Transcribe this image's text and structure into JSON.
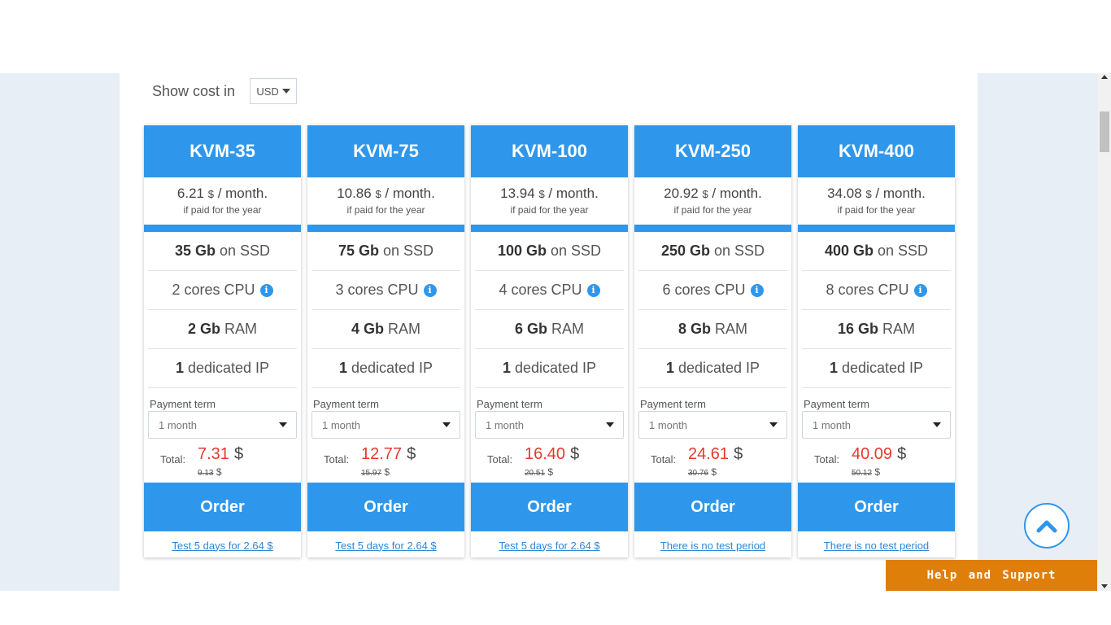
{
  "currency": {
    "label": "Show cost in",
    "selected": "USD"
  },
  "plans": [
    {
      "name": "KVM-35",
      "price": "6.21",
      "price_currency": "$",
      "price_unit": "/ month.",
      "price_note": "if paid for the year",
      "ssd_value": "35 Gb",
      "ssd_text": "on SSD",
      "cpu_text": "2 cores CPU",
      "ram_value": "2 Gb",
      "ram_text": "RAM",
      "ip_value": "1",
      "ip_text": "dedicated IP",
      "term_label": "Payment term",
      "term_value": "1 month",
      "total_label": "Total:",
      "total_value": "7.31",
      "total_currency": "$",
      "old_price": "9.13",
      "old_currency": "$",
      "order_label": "Order",
      "test_label": "Test 5 days for 2.64 $"
    },
    {
      "name": "KVM-75",
      "price": "10.86",
      "price_currency": "$",
      "price_unit": "/ month.",
      "price_note": "if paid for the year",
      "ssd_value": "75 Gb",
      "ssd_text": "on SSD",
      "cpu_text": "3 cores CPU",
      "ram_value": "4 Gb",
      "ram_text": "RAM",
      "ip_value": "1",
      "ip_text": "dedicated IP",
      "term_label": "Payment term",
      "term_value": "1 month",
      "total_label": "Total:",
      "total_value": "12.77",
      "total_currency": "$",
      "old_price": "15.97",
      "old_currency": "$",
      "order_label": "Order",
      "test_label": "Test 5 days for 2.64 $"
    },
    {
      "name": "KVM-100",
      "price": "13.94",
      "price_currency": "$",
      "price_unit": "/ month.",
      "price_note": "if paid for the year",
      "ssd_value": "100 Gb",
      "ssd_text": "on SSD",
      "cpu_text": "4 cores CPU",
      "ram_value": "6 Gb",
      "ram_text": "RAM",
      "ip_value": "1",
      "ip_text": "dedicated IP",
      "term_label": "Payment term",
      "term_value": "1 month",
      "total_label": "Total:",
      "total_value": "16.40",
      "total_currency": "$",
      "old_price": "20.51",
      "old_currency": "$",
      "order_label": "Order",
      "test_label": "Test 5 days for 2.64 $"
    },
    {
      "name": "KVM-250",
      "price": "20.92",
      "price_currency": "$",
      "price_unit": "/ month.",
      "price_note": "if paid for the year",
      "ssd_value": "250 Gb",
      "ssd_text": "on SSD",
      "cpu_text": "6 cores CPU",
      "ram_value": "8 Gb",
      "ram_text": "RAM",
      "ip_value": "1",
      "ip_text": "dedicated IP",
      "term_label": "Payment term",
      "term_value": "1 month",
      "total_label": "Total:",
      "total_value": "24.61",
      "total_currency": "$",
      "old_price": "30.76",
      "old_currency": "$",
      "order_label": "Order",
      "test_label": "There is no test period"
    },
    {
      "name": "KVM-400",
      "price": "34.08",
      "price_currency": "$",
      "price_unit": "/ month.",
      "price_note": "if paid for the year",
      "ssd_value": "400 Gb",
      "ssd_text": "on SSD",
      "cpu_text": "8 cores CPU",
      "ram_value": "16 Gb",
      "ram_text": "RAM",
      "ip_value": "1",
      "ip_text": "dedicated IP",
      "term_label": "Payment term",
      "term_value": "1 month",
      "total_label": "Total:",
      "total_value": "40.09",
      "total_currency": "$",
      "old_price": "50.12",
      "old_currency": "$",
      "order_label": "Order",
      "test_label": "There is no test period"
    }
  ],
  "icons": {
    "info": "info-icon",
    "back_to_top": "chevron-up-icon"
  },
  "help": {
    "label": "Help and Support"
  },
  "colors": {
    "accent": "#2e97ec",
    "price_red": "#e5392f",
    "help_orange": "#df7f0a",
    "page_bg": "#e8eef6"
  }
}
